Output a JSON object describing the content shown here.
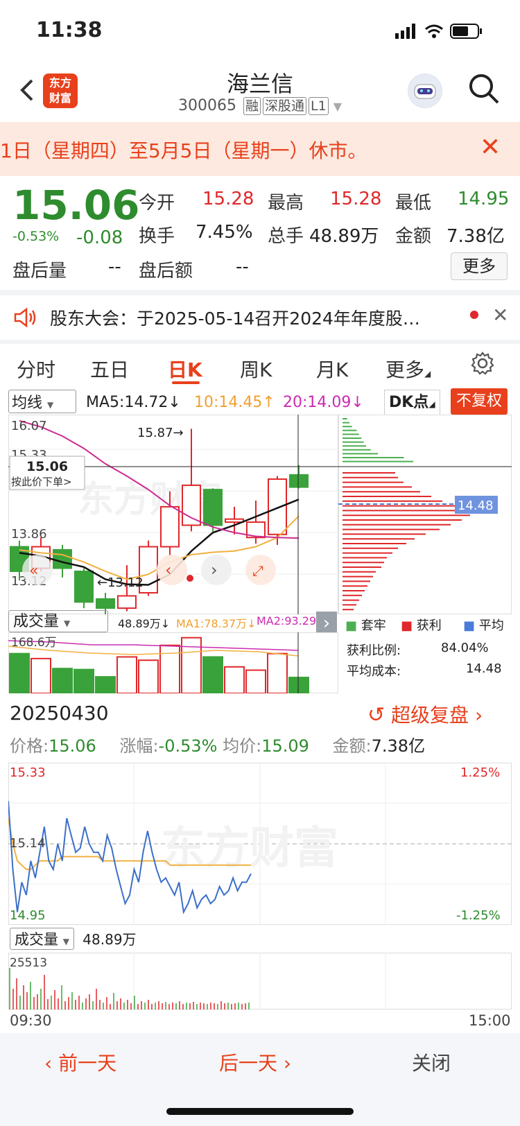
{
  "status_bar": {
    "time": "11:38"
  },
  "header": {
    "logo_line1": "东方",
    "logo_line2": "财富",
    "name": "海兰信",
    "code": "300065",
    "tags": [
      "融",
      "深股通",
      "L1"
    ]
  },
  "notice": {
    "text": "1日（星期四）至5月5日（星期一）休市。"
  },
  "quote": {
    "price": "15.06",
    "change_pct": "-0.53%",
    "change": "-0.08",
    "fields": [
      {
        "label": "今开",
        "value": "15.28",
        "color": "red"
      },
      {
        "label": "最高",
        "value": "15.28",
        "color": "red"
      },
      {
        "label": "最低",
        "value": "14.95",
        "color": "green"
      },
      {
        "label": "换手",
        "value": "7.45%",
        "color": "black"
      },
      {
        "label": "总手",
        "value": "48.89万",
        "color": "black"
      },
      {
        "label": "金额",
        "value": "7.38亿",
        "color": "black"
      },
      {
        "label": "盘后量",
        "value": "--",
        "color": "black"
      },
      {
        "label": "盘后额",
        "value": "--",
        "color": "black"
      }
    ],
    "more": "更多"
  },
  "announcement": {
    "text": "股东大会：于2025-05-14召开2024年年度股…"
  },
  "tabs": [
    "分时",
    "五日",
    "日K",
    "周K",
    "月K",
    "更多"
  ],
  "active_tab": "日K",
  "indicators": {
    "ma_select": "均线",
    "ma5": "MA5:14.72↓",
    "ma10": "10:14.45↑",
    "ma20": "20:14.09↓",
    "dk": "DK点",
    "fq": "不复权"
  },
  "kline": {
    "y_max": "16.07",
    "y_mid": "15.33",
    "y_low": "13.86",
    "y_min": "13.12",
    "high_label": "15.87→",
    "low_label": "←13.12",
    "cursor_price": "15.06",
    "order_hint": "按此价下单>",
    "candles": [
      {
        "o": 13.95,
        "c": 13.55,
        "h": 14.05,
        "l": 13.4
      },
      {
        "o": 13.6,
        "c": 13.95,
        "h": 14.1,
        "l": 13.55
      },
      {
        "o": 13.9,
        "c": 13.6,
        "h": 13.98,
        "l": 13.45
      },
      {
        "o": 13.55,
        "c": 13.05,
        "h": 13.6,
        "l": 12.95
      },
      {
        "o": 13.1,
        "c": 12.95,
        "h": 13.2,
        "l": 12.85
      },
      {
        "o": 12.95,
        "c": 13.15,
        "h": 13.65,
        "l": 12.9
      },
      {
        "o": 13.2,
        "c": 13.95,
        "h": 14.05,
        "l": 13.15
      },
      {
        "o": 13.95,
        "c": 14.6,
        "h": 14.85,
        "l": 13.8
      },
      {
        "o": 14.3,
        "c": 14.95,
        "h": 15.87,
        "l": 14.2
      },
      {
        "o": 14.88,
        "c": 14.3,
        "h": 14.9,
        "l": 14.2
      },
      {
        "o": 14.35,
        "c": 14.4,
        "h": 14.6,
        "l": 14.15
      },
      {
        "o": 14.1,
        "c": 14.35,
        "h": 14.7,
        "l": 14.0
      },
      {
        "o": 14.15,
        "c": 15.05,
        "h": 15.1,
        "l": 13.98
      },
      {
        "o": 15.12,
        "c": 14.92,
        "h": 15.28,
        "l": 14.9
      }
    ],
    "ma5": [
      13.85,
      13.8,
      13.7,
      13.62,
      13.42,
      13.34,
      13.33,
      13.5,
      13.88,
      14.18,
      14.3,
      14.44,
      14.58,
      14.72
    ],
    "ma10": [
      13.9,
      13.85,
      13.82,
      13.7,
      13.55,
      13.42,
      13.5,
      13.7,
      13.82,
      13.86,
      13.88,
      13.95,
      14.1,
      14.45
    ],
    "ma20": [
      16.0,
      15.9,
      15.75,
      15.55,
      15.3,
      15.1,
      14.88,
      14.62,
      14.42,
      14.27,
      14.18,
      14.12,
      14.1,
      14.09
    ]
  },
  "volume_profile": {
    "current_cost": "14.48",
    "legend": [
      "套牢",
      "获利",
      "平均"
    ],
    "stats": [
      {
        "label": "获利比例:",
        "value": "84.04%"
      },
      {
        "label": "平均成本:",
        "value": "14.48"
      }
    ],
    "bars_green": [
      4,
      6,
      8,
      12,
      14,
      16,
      18,
      20,
      24,
      30,
      52,
      60
    ],
    "bars_red": [
      38,
      40,
      44,
      50,
      56,
      64,
      72,
      82,
      88,
      92,
      86,
      78,
      70,
      60,
      52,
      46,
      40,
      36,
      32,
      30,
      28,
      24,
      22,
      20,
      18,
      16,
      14,
      12,
      10,
      8
    ]
  },
  "volume": {
    "select": "成交量",
    "value": "48.89万↓",
    "ma1": "MA1:78.37万↓",
    "ma2": "MA2:93.29...",
    "max": "168.6万",
    "bars": [
      {
        "v": 120,
        "up": false
      },
      {
        "v": 105,
        "up": true
      },
      {
        "v": 75,
        "up": false
      },
      {
        "v": 72,
        "up": false
      },
      {
        "v": 50,
        "up": false
      },
      {
        "v": 110,
        "up": true
      },
      {
        "v": 100,
        "up": true
      },
      {
        "v": 145,
        "up": true
      },
      {
        "v": 168,
        "up": true
      },
      {
        "v": 110,
        "up": false
      },
      {
        "v": 80,
        "up": true
      },
      {
        "v": 70,
        "up": true
      },
      {
        "v": 120,
        "up": true
      },
      {
        "v": 48,
        "up": false
      }
    ]
  },
  "timeshare": {
    "date": "20250430",
    "replay": "超级复盘",
    "info": {
      "price_label": "价格:",
      "price": "15.06",
      "change_label": "涨幅:",
      "change": "-0.53%",
      "avg_label": "均价:",
      "avg": "15.09",
      "amount_label": "金额:",
      "amount": "7.38亿"
    },
    "y_high": "15.33",
    "y_mid": "15.14",
    "y_low": "14.95",
    "pct_high": "1.25%",
    "pct_low": "-1.25%",
    "vol_select": "成交量",
    "vol_value": "48.89万",
    "vol_max": "25513",
    "t_start": "09:30",
    "t_end": "15:00",
    "price_series": [
      15.24,
      15.08,
      14.98,
      15.05,
      15.02,
      15.1,
      15.06,
      15.12,
      15.18,
      15.1,
      15.08,
      15.14,
      15.1,
      15.2,
      15.16,
      15.12,
      15.13,
      15.18,
      15.14,
      15.12,
      15.12,
      15.1,
      15.16,
      15.13,
      15.08,
      15.04,
      15.0,
      15.02,
      15.08,
      15.05,
      15.12,
      15.17,
      15.12,
      15.08,
      15.05,
      15.06,
      15.04,
      15.02,
      15.05,
      14.98,
      15.0,
      15.03,
      14.99,
      15.01,
      15.02,
      15.0,
      15.01,
      15.04,
      15.02,
      15.03,
      15.06,
      15.03,
      15.05,
      15.05,
      15.07
    ],
    "avg_series": [
      15.2,
      15.14,
      15.1,
      15.09,
      15.08,
      15.08,
      15.09,
      15.1,
      15.1,
      15.1,
      15.1,
      15.1,
      15.11,
      15.11,
      15.11,
      15.11,
      15.11,
      15.11,
      15.11,
      15.11,
      15.11,
      15.1,
      15.1,
      15.1,
      15.1,
      15.1,
      15.1,
      15.1,
      15.1,
      15.1,
      15.1,
      15.1,
      15.1,
      15.1,
      15.1,
      15.1,
      15.09,
      15.09,
      15.09,
      15.09,
      15.09,
      15.09,
      15.09,
      15.09,
      15.09,
      15.09,
      15.09,
      15.09,
      15.09,
      15.09,
      15.09,
      15.09,
      15.09,
      15.09,
      15.09
    ]
  },
  "bottom_nav": {
    "prev": "前一天",
    "next": "后一天",
    "close": "关闭"
  }
}
